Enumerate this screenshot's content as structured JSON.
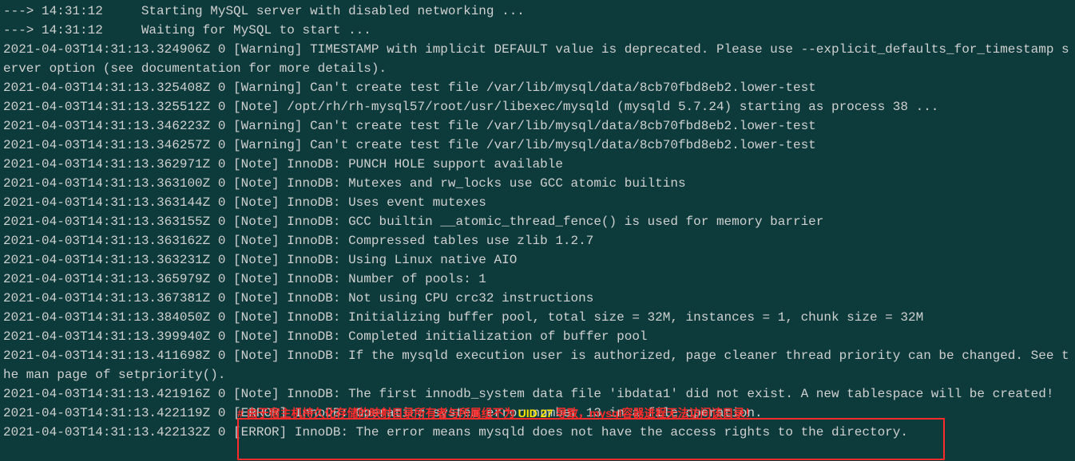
{
  "terminal": {
    "lines": [
      "---> 14:31:12     Starting MySQL server with disabled networking ...",
      "---> 14:31:12     Waiting for MySQL to start ...",
      "2021-04-03T14:31:13.324906Z 0 [Warning] TIMESTAMP with implicit DEFAULT value is deprecated. Please use --explicit_defaults_for_timestamp server option (see documentation for more details).",
      "2021-04-03T14:31:13.325408Z 0 [Warning] Can't create test file /var/lib/mysql/data/8cb70fbd8eb2.lower-test",
      "2021-04-03T14:31:13.325512Z 0 [Note] /opt/rh/rh-mysql57/root/usr/libexec/mysqld (mysqld 5.7.24) starting as process 38 ...",
      "2021-04-03T14:31:13.346223Z 0 [Warning] Can't create test file /var/lib/mysql/data/8cb70fbd8eb2.lower-test",
      "2021-04-03T14:31:13.346257Z 0 [Warning] Can't create test file /var/lib/mysql/data/8cb70fbd8eb2.lower-test",
      "2021-04-03T14:31:13.362971Z 0 [Note] InnoDB: PUNCH HOLE support available",
      "2021-04-03T14:31:13.363100Z 0 [Note] InnoDB: Mutexes and rw_locks use GCC atomic builtins",
      "2021-04-03T14:31:13.363144Z 0 [Note] InnoDB: Uses event mutexes",
      "2021-04-03T14:31:13.363155Z 0 [Note] InnoDB: GCC builtin __atomic_thread_fence() is used for memory barrier",
      "2021-04-03T14:31:13.363162Z 0 [Note] InnoDB: Compressed tables use zlib 1.2.7",
      "2021-04-03T14:31:13.363231Z 0 [Note] InnoDB: Using Linux native AIO",
      "2021-04-03T14:31:13.365979Z 0 [Note] InnoDB: Number of pools: 1",
      "2021-04-03T14:31:13.367381Z 0 [Note] InnoDB: Not using CPU crc32 instructions",
      "2021-04-03T14:31:13.384050Z 0 [Note] InnoDB: Initializing buffer pool, total size = 32M, instances = 1, chunk size = 32M",
      "2021-04-03T14:31:13.399940Z 0 [Note] InnoDB: Completed initialization of buffer pool",
      "2021-04-03T14:31:13.411698Z 0 [Note] InnoDB: If the mysqld execution user is authorized, page cleaner thread priority can be changed. See the man page of setpriority().",
      "2021-04-03T14:31:13.421916Z 0 [Note] InnoDB: The first innodb_system data file 'ibdata1' did not exist. A new tablespace will be created!",
      "2021-04-03T14:31:13.422119Z 0 [ERROR] InnoDB: Operating system error number 13 in a file operation.",
      "2021-04-03T14:31:13.422132Z 0 [ERROR] InnoDB: The error means mysqld does not have the access rights to the directory."
    ]
  },
  "annotation": {
    "prefix": "# 由于宿主机持久化存储的映射目录所有者与所属组不为 ",
    "highlight": "UID 27",
    "suffix": " 导致，mysql容器进程无法访问该目录！"
  }
}
